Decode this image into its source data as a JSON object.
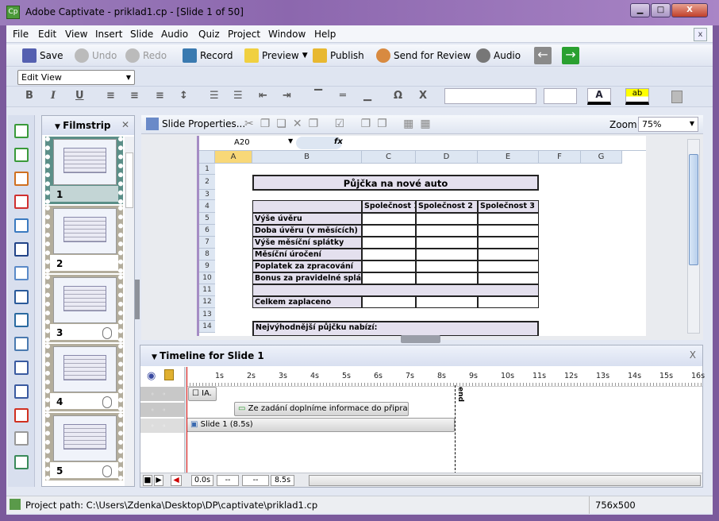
{
  "window": {
    "title": "Adobe Captivate - priklad1.cp - [Slide 1 of 50]",
    "app_icon": "Cp",
    "min": "▁",
    "max": "□",
    "close": "X"
  },
  "menu": [
    "File",
    "Edit",
    "View",
    "Insert",
    "Slide",
    "Audio",
    "Quiz",
    "Project",
    "Window",
    "Help"
  ],
  "menu_close": "x",
  "toolbar": {
    "save": "Save",
    "undo": "Undo",
    "redo": "Redo",
    "record": "Record",
    "preview": "Preview",
    "publish": "Publish",
    "send_review": "Send for Review",
    "audio": "Audio"
  },
  "edit_view": "Edit View",
  "format": {
    "bold": "B",
    "italic": "I",
    "underline": "U",
    "omega": "Ω",
    "font_color": "A",
    "highlight": "ab"
  },
  "filmstrip": {
    "title": "Filmstrip",
    "close": "✕",
    "slides": [
      {
        "n": "1",
        "selected": true
      },
      {
        "n": "2"
      },
      {
        "n": "3",
        "click": true
      },
      {
        "n": "4",
        "click": true
      },
      {
        "n": "5",
        "click": true
      }
    ]
  },
  "slide_toolbar": {
    "properties": "Slide Properties...",
    "zoom_label": "Zoom:",
    "zoom_value": "75%"
  },
  "sheet": {
    "name_box": "A20",
    "fx": "fx",
    "columns": [
      "A",
      "B",
      "C",
      "D",
      "E",
      "F",
      "G"
    ],
    "rows": [
      "1",
      "2",
      "3",
      "4",
      "5",
      "6",
      "7",
      "8",
      "9",
      "10",
      "11",
      "12",
      "13",
      "14"
    ],
    "title": "Půjčka na nové auto",
    "headers": [
      "Společnost 1",
      "Společnost 2",
      "Společnost 3"
    ],
    "labels": [
      "Výše úvěru",
      "Doba úvěru (v měsících)",
      "Výše měsíční splátky",
      "Měsíční úročení",
      "Poplatek za zpracování",
      "Bonus za pravidelné splátky"
    ],
    "total": "Celkem zaplaceno",
    "best": "Nejvýhodnější půjčku nabízí:"
  },
  "timeline": {
    "title": "Timeline for Slide 1",
    "close": "X",
    "ticks": [
      "1s",
      "2s",
      "3s",
      "4s",
      "5s",
      "6s",
      "7s",
      "8s",
      "9s",
      "10s",
      "11s",
      "12s",
      "13s",
      "14s",
      "15s",
      "16s"
    ],
    "caption": "Ze zadání doplníme informace do připravené ...",
    "slide": "Slide 1 (8.5s)",
    "end": "end",
    "obj": "IA.",
    "time_current": "0.0s",
    "time_a": "--",
    "time_b": "--",
    "time_total": "8.5s"
  },
  "status": {
    "path": "Project path: C:\\Users\\Zdenka\\Desktop\\DP\\captivate\\priklad1.cp",
    "size": "756x500"
  }
}
